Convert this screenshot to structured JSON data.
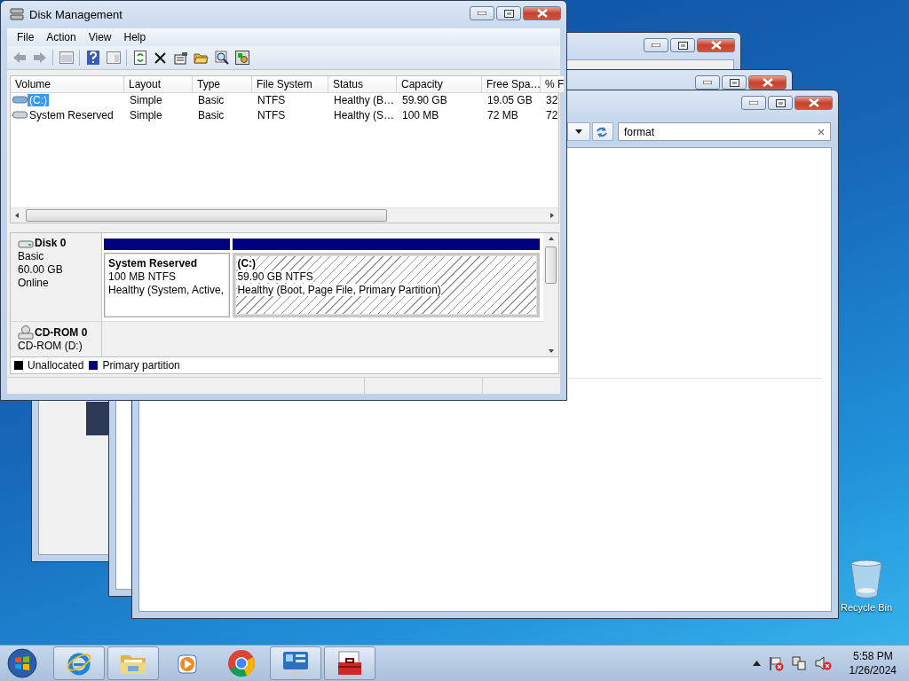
{
  "disk_management": {
    "title": "Disk Management",
    "menu": [
      "File",
      "Action",
      "View",
      "Help"
    ],
    "volume_list": {
      "columns": [
        "Volume",
        "Layout",
        "Type",
        "File System",
        "Status",
        "Capacity",
        "Free Spa…",
        "% F"
      ],
      "rows": [
        {
          "selected": true,
          "kind": "system",
          "cells": [
            "(C:)",
            "Simple",
            "Basic",
            "NTFS",
            "Healthy (B…",
            "59.90 GB",
            "19.05 GB",
            "32"
          ]
        },
        {
          "selected": false,
          "kind": "system",
          "cells": [
            "System Reserved",
            "Simple",
            "Basic",
            "NTFS",
            "Healthy (S…",
            "100 MB",
            "72 MB",
            "72"
          ]
        }
      ]
    },
    "disks": [
      {
        "kind": "disk",
        "name": "Disk 0",
        "lines": [
          "Basic",
          "60.00 GB",
          "Online"
        ],
        "partitions": [
          {
            "name": "System Reserved",
            "size": "100 MB NTFS",
            "status": "Healthy (System, Active,",
            "selected": false
          },
          {
            "name": "(C:)",
            "size": "59.90 GB NTFS",
            "status": "Healthy (Boot, Page File, Primary Partition)",
            "selected": true
          }
        ]
      },
      {
        "kind": "cdrom",
        "name": "CD-ROM 0",
        "lines": [
          "CD-ROM (D:)"
        ]
      }
    ],
    "legend": [
      {
        "label": "Unallocated",
        "color": "#000000"
      },
      {
        "label": "Primary partition",
        "color": "#000080"
      }
    ]
  },
  "explorer_window": {
    "search": {
      "value": "format"
    }
  },
  "desktop_icons": [
    {
      "label": "Recycle Bin"
    }
  ],
  "taskbar": {
    "apps": [
      {
        "kind": "ie",
        "running": true
      },
      {
        "kind": "explorer",
        "running": true
      },
      {
        "kind": "media",
        "running": false
      },
      {
        "kind": "chrome",
        "running": false
      },
      {
        "kind": "controlpanel",
        "running": true
      },
      {
        "kind": "toolbox",
        "running": true
      }
    ],
    "time": "5:58 PM",
    "date": "1/26/2024"
  }
}
